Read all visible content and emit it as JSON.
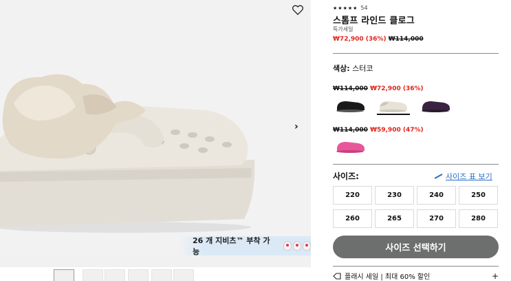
{
  "product": {
    "rating_count": "54",
    "title": "스톰프 라인드 클로그",
    "subtitle": "특가세일",
    "sale_price": "₩72,900 (36%)",
    "original_price": "₩114,000"
  },
  "gallery": {
    "jibbitz_text": "26 개 지비츠™ 부착 가능",
    "wishlist_icon": "heart-icon",
    "next_icon": "chevron-right-icon"
  },
  "color": {
    "label": "색상:",
    "value": "스터코",
    "groups": [
      {
        "original_price": "₩114,000",
        "sale_price": "₩72,900 (36%)",
        "swatches": [
          {
            "name": "black",
            "color": "#1a1a1a"
          },
          {
            "name": "stucco",
            "color": "#e6e2d6",
            "selected": true
          },
          {
            "name": "purple",
            "color": "#3a2340"
          }
        ]
      },
      {
        "original_price": "₩114,000",
        "sale_price": "₩59,900 (47%)",
        "swatches": [
          {
            "name": "pink",
            "color": "#e8579a"
          }
        ]
      }
    ]
  },
  "size": {
    "label": "사이즈:",
    "guide_label": "사이즈 표 보기",
    "options": [
      "220",
      "230",
      "240",
      "250",
      "260",
      "265",
      "270",
      "280"
    ]
  },
  "cta_label": "사이즈 선택하기",
  "flash_sale": "플래시 세일 | 최대 60% 할인",
  "flash_expand": "+",
  "colors": {
    "sale": "#e0261b",
    "link": "#2a6dc8",
    "cta": "#6d6f6f"
  }
}
